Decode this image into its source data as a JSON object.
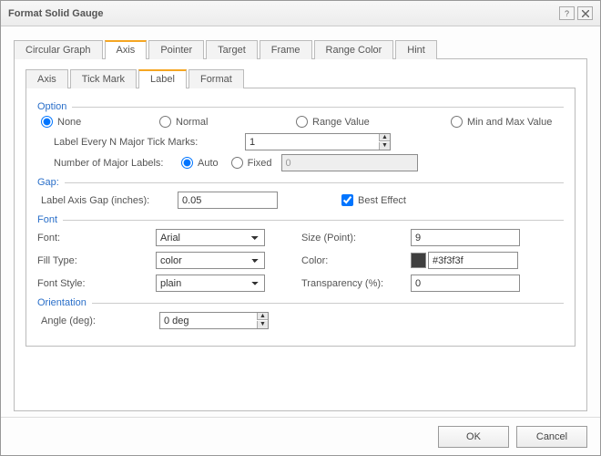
{
  "title": "Format Solid Gauge",
  "topTabs": [
    "Circular Graph",
    "Axis",
    "Pointer",
    "Target",
    "Frame",
    "Range Color",
    "Hint"
  ],
  "topActive": 1,
  "subTabs": [
    "Axis",
    "Tick Mark",
    "Label",
    "Format"
  ],
  "subActive": 2,
  "option": {
    "title": "Option",
    "radios": {
      "none": "None",
      "normal": "Normal",
      "rangeValue": "Range Value",
      "minMax": "Min and Max Value"
    },
    "radioSelected": "none",
    "everyNLabel": "Label Every N Major Tick Marks:",
    "everyNValue": "1",
    "numLabelsLabel": "Number of Major Labels:",
    "autoLabel": "Auto",
    "fixedLabel": "Fixed",
    "numLabelsMode": "auto",
    "fixedValue": "0"
  },
  "gap": {
    "title": "Gap:",
    "axisGapLabel": "Label Axis Gap (inches):",
    "axisGapValue": "0.05",
    "bestEffectLabel": "Best Effect",
    "bestEffect": true
  },
  "font": {
    "title": "Font",
    "fontLabel": "Font:",
    "fontValue": "Arial",
    "sizeLabel": "Size (Point):",
    "sizeValue": "9",
    "fillTypeLabel": "Fill Type:",
    "fillTypeValue": "color",
    "colorLabel": "Color:",
    "colorValue": "#3f3f3f",
    "styleLabel": "Font Style:",
    "styleValue": "plain",
    "transparencyLabel": "Transparency (%):",
    "transparencyValue": "0"
  },
  "orientation": {
    "title": "Orientation",
    "angleLabel": "Angle (deg):",
    "angleValue": "0 deg"
  },
  "buttons": {
    "ok": "OK",
    "cancel": "Cancel"
  }
}
